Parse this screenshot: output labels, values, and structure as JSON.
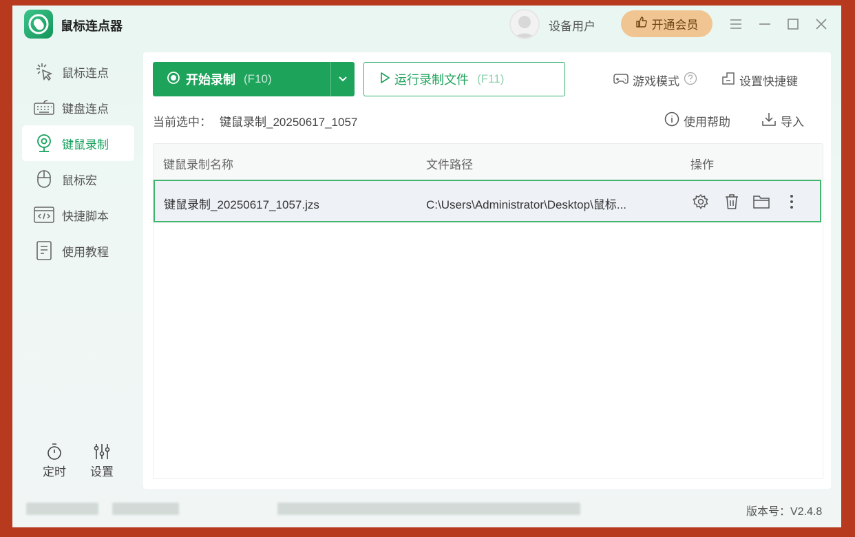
{
  "app": {
    "title": "鼠标连点器"
  },
  "user": {
    "name": "设备用户",
    "vip_label": "开通会员"
  },
  "sidebar": {
    "items": [
      {
        "label": "鼠标连点",
        "icon": "mouse-click-icon",
        "active": false
      },
      {
        "label": "键盘连点",
        "icon": "keyboard-icon",
        "active": false
      },
      {
        "label": "键鼠录制",
        "icon": "webcam-record-icon",
        "active": true
      },
      {
        "label": "鼠标宏",
        "icon": "mouse-icon",
        "active": false
      },
      {
        "label": "快捷脚本",
        "icon": "code-window-icon",
        "active": false
      },
      {
        "label": "使用教程",
        "icon": "document-icon",
        "active": false
      }
    ],
    "bottom": [
      {
        "label": "定时",
        "icon": "timer-icon"
      },
      {
        "label": "设置",
        "icon": "sliders-icon"
      }
    ]
  },
  "toolbar": {
    "record_label": "开始录制",
    "record_key": "(F10)",
    "run_label": "运行录制文件",
    "run_key": "(F11)",
    "game_mode": "游戏模式",
    "shortcut": "设置快捷键",
    "help": "使用帮助",
    "import": "导入"
  },
  "selection": {
    "prefix": "当前选中：",
    "value": "键鼠录制_20250617_1057"
  },
  "table": {
    "headers": [
      "键鼠录制名称",
      "文件路径",
      "操作"
    ],
    "rows": [
      {
        "name": "键鼠录制_20250617_1057.jzs",
        "path": "C:\\Users\\Administrator\\Desktop\\鼠标...",
        "selected": true
      }
    ]
  },
  "footer": {
    "version": "版本号：V2.4.8"
  },
  "colors": {
    "accent": "#1ea35b",
    "vip": "#f1c591",
    "frame": "#b83a1e"
  }
}
